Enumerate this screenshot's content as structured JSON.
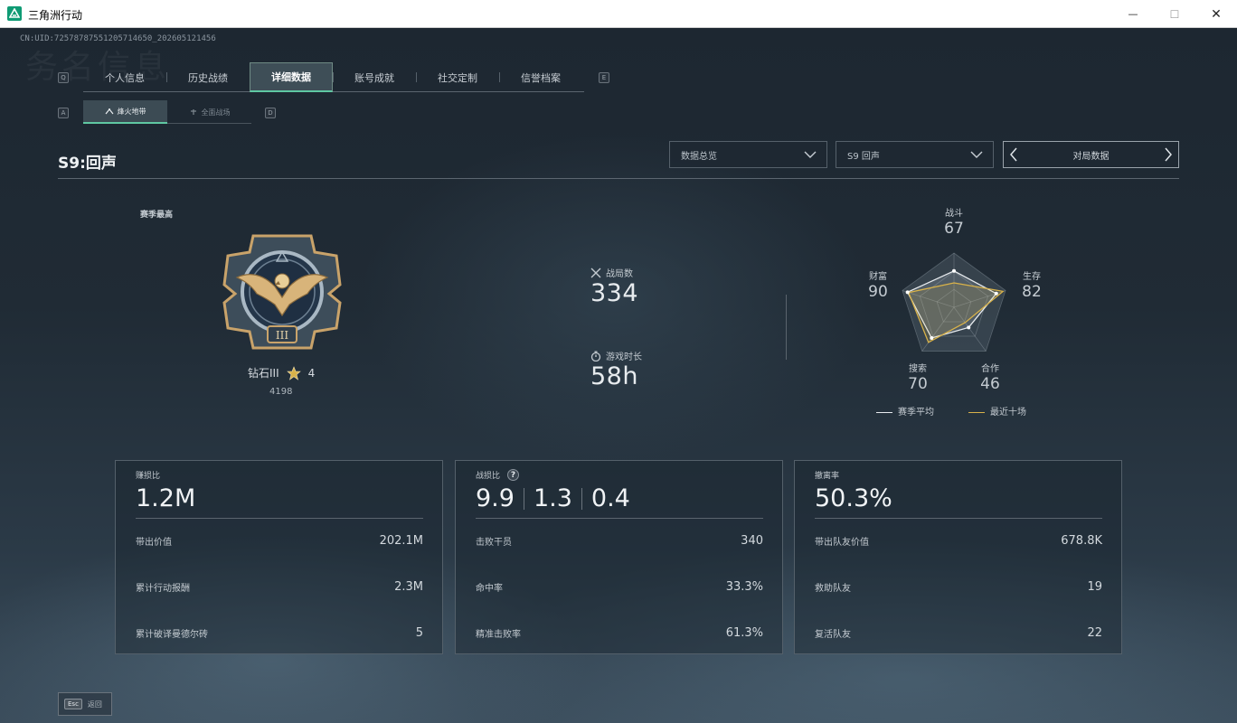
{
  "window": {
    "title": "三角洲行动",
    "minimize": "—",
    "maximize": "☐",
    "close": "✕"
  },
  "uid": "CN:UID:7257878755120571465​0_202605121456",
  "bg_watermark": "务名信息",
  "keys": {
    "prev_tab": "Q",
    "next_tab": "E",
    "prev_sub": "A",
    "next_sub": "D"
  },
  "tabs": [
    {
      "label": "个人信息"
    },
    {
      "label": "历史战绩"
    },
    {
      "label": "详细数据"
    },
    {
      "label": "账号成就"
    },
    {
      "label": "社交定制"
    },
    {
      "label": "信誉档案"
    }
  ],
  "subtabs": [
    {
      "label": "烽火地带"
    },
    {
      "label": "全面战场"
    }
  ],
  "season_title": "S9:回声",
  "dropdowns": {
    "overview": "数据总览",
    "season": "S9 回声"
  },
  "pager_label": "对局数据",
  "rank": {
    "label": "赛季最高",
    "name": "钻石III",
    "stars": "4",
    "score": "4198",
    "tier_numeral": "III"
  },
  "games": {
    "label": "战局数",
    "value": "334"
  },
  "playtime": {
    "label": "游戏时长",
    "value": "58h"
  },
  "radar": {
    "axes": [
      {
        "label": "战斗",
        "value": "67"
      },
      {
        "label": "生存",
        "value": "82"
      },
      {
        "label": "合作",
        "value": "46"
      },
      {
        "label": "搜索",
        "value": "70"
      },
      {
        "label": "财富",
        "value": "90"
      }
    ],
    "season_avg": [
      67,
      82,
      46,
      70,
      90
    ],
    "recent_ten": [
      45,
      95,
      35,
      80,
      88
    ],
    "legend": {
      "season_avg": "赛季平均",
      "recent": "最近十场"
    },
    "colors": {
      "season_avg": "#e8ecef",
      "recent": "#d8b24a"
    }
  },
  "cards": [
    {
      "label": "赚损比",
      "big": "1.2M",
      "rows": [
        {
          "label": "带出价值",
          "value": "202.1M"
        },
        {
          "label": "累计行动报酬",
          "value": "2.3M"
        },
        {
          "label": "累计破译曼德尔砖",
          "value": "5"
        }
      ]
    },
    {
      "label": "战损比",
      "help": "?",
      "big_parts": [
        "9.9",
        "1.3",
        "0.4"
      ],
      "rows": [
        {
          "label": "击败干员",
          "value": "340"
        },
        {
          "label": "命中率",
          "value": "33.3%"
        },
        {
          "label": "精准击败率",
          "value": "61.3%"
        }
      ]
    },
    {
      "label": "撤离率",
      "big": "50.3%",
      "rows": [
        {
          "label": "带出队友价值",
          "value": "678.8K"
        },
        {
          "label": "救助队友",
          "value": "19"
        },
        {
          "label": "复活队友",
          "value": "22"
        }
      ]
    }
  ],
  "esc": {
    "key": "Esc",
    "label": "返回"
  }
}
